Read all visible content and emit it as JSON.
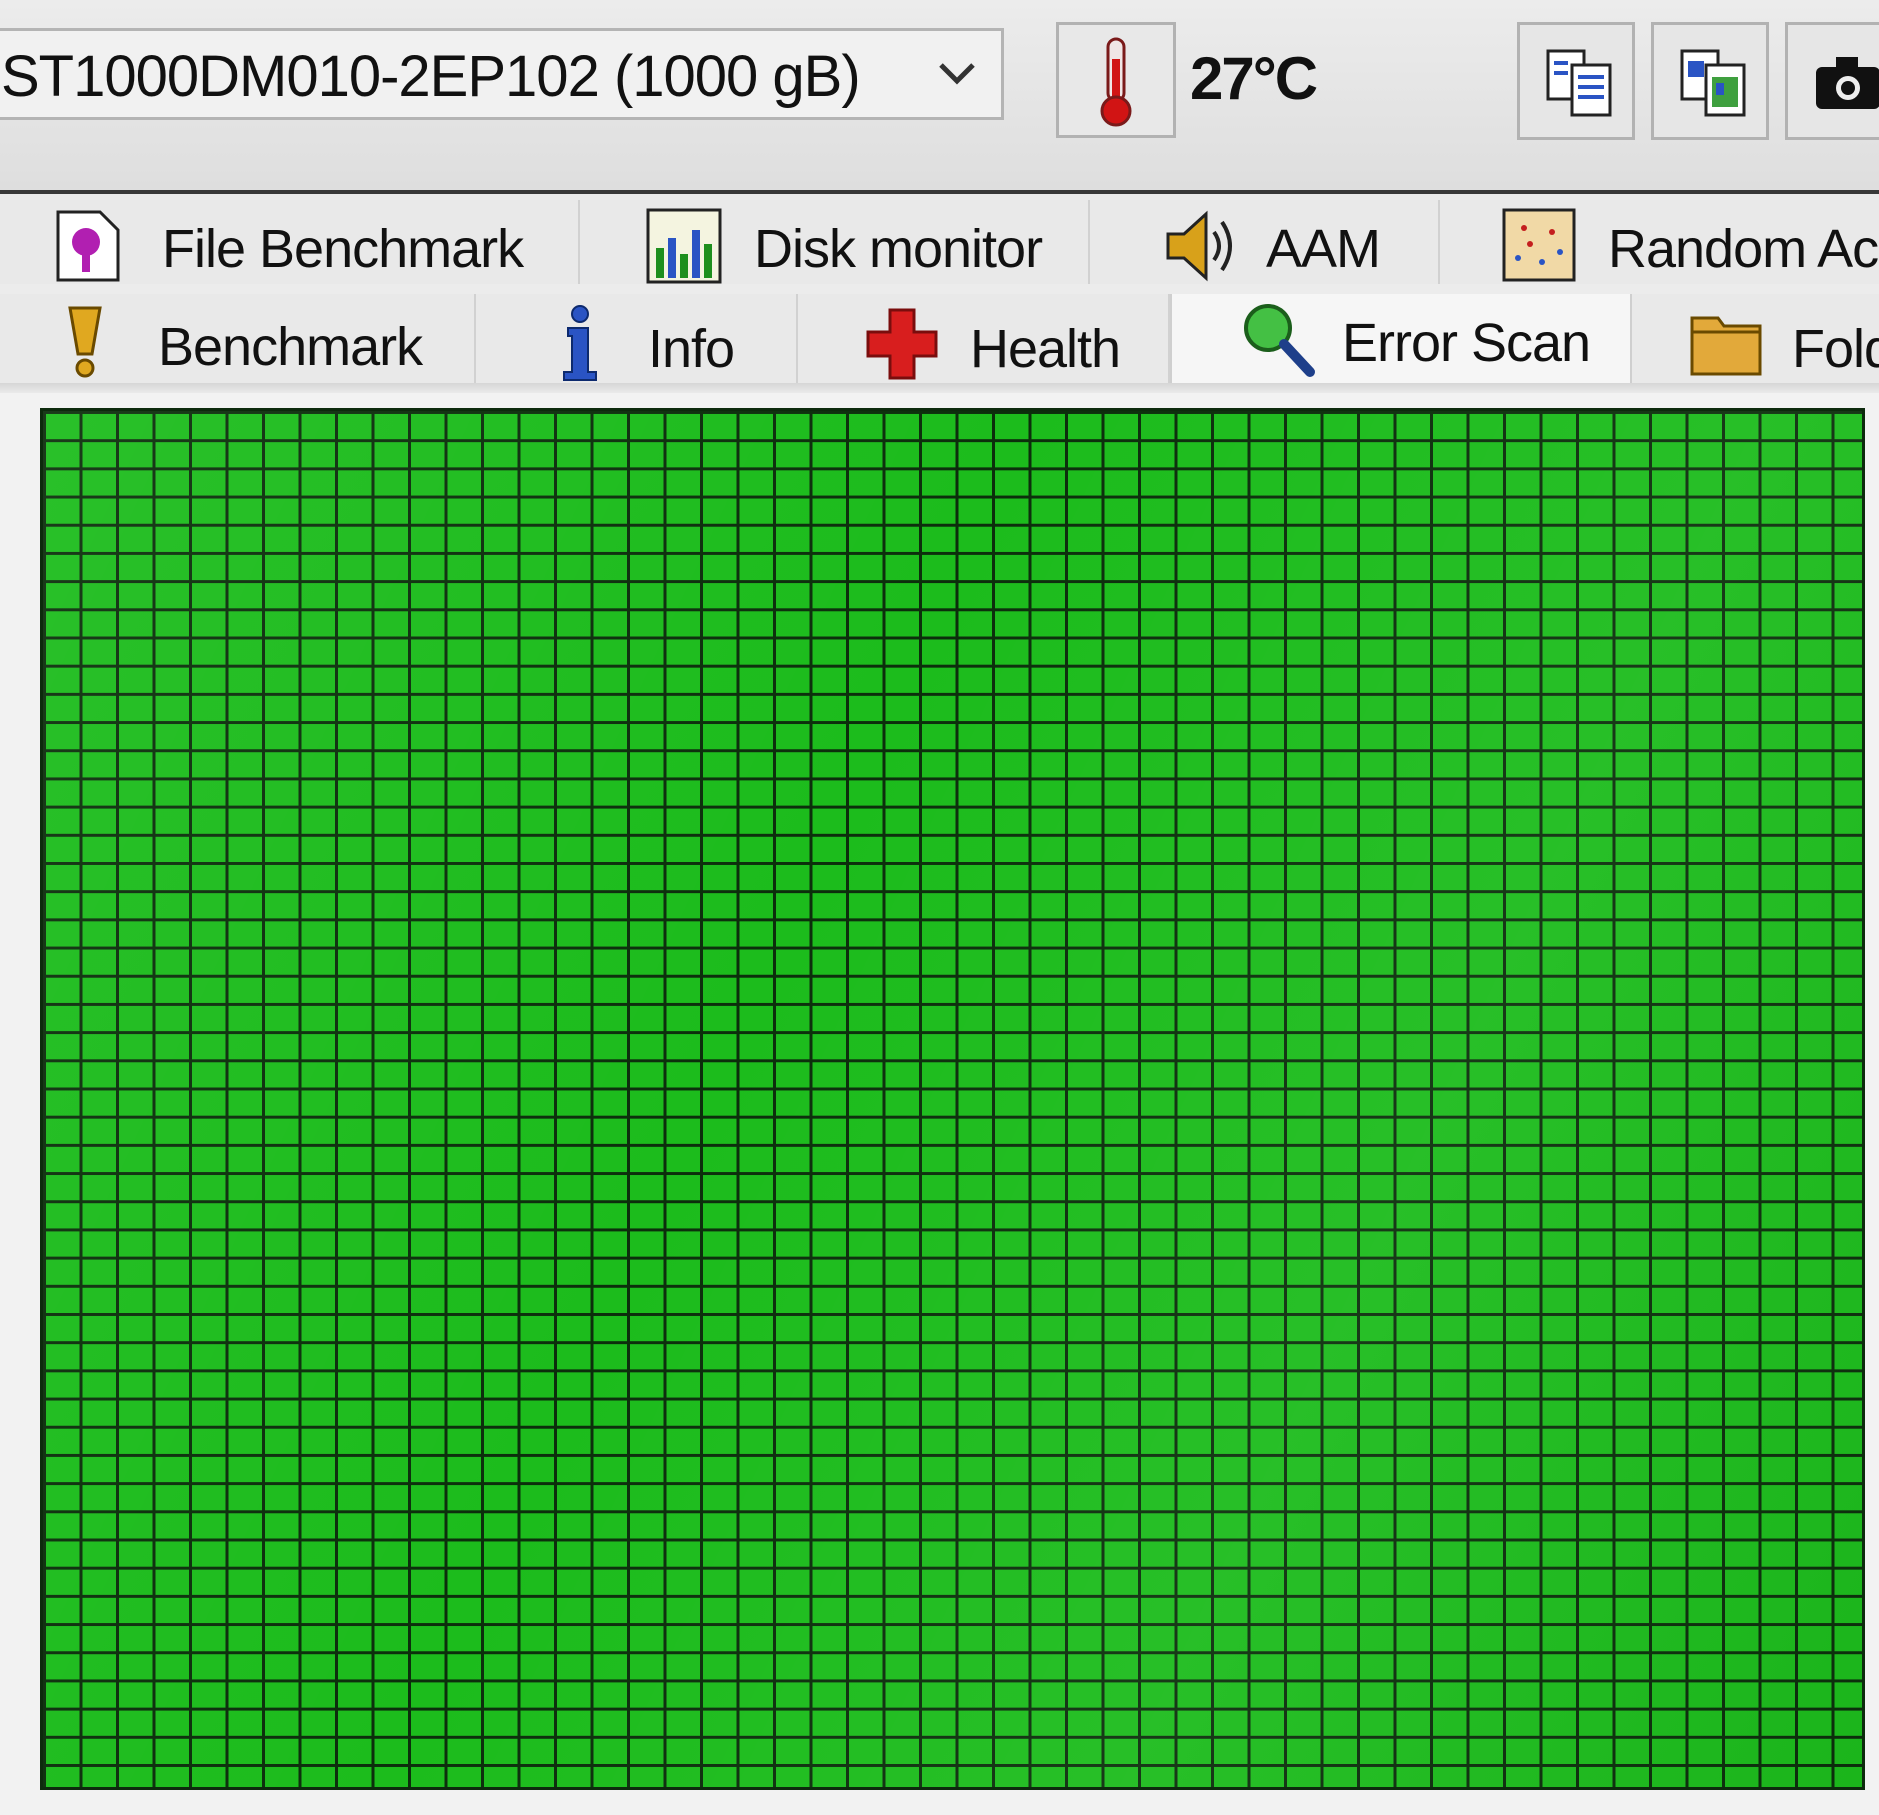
{
  "toolbar": {
    "drive_label": "ST1000DM010-2EP102 (1000 gB)",
    "temperature": "27°C",
    "icons": [
      "chevron-down-icon",
      "thermometer-icon",
      "copy-text-icon",
      "copy-image-icon",
      "camera-icon"
    ]
  },
  "tabs": {
    "row1": [
      {
        "label": "File Benchmark",
        "icon": "file-benchmark-icon"
      },
      {
        "label": "Disk monitor",
        "icon": "bar-chart-icon"
      },
      {
        "label": "AAM",
        "icon": "speaker-icon"
      },
      {
        "label": "Random Acc",
        "icon": "random-access-icon"
      }
    ],
    "row2": [
      {
        "label": "Benchmark",
        "icon": "exclamation-icon"
      },
      {
        "label": "Info",
        "icon": "info-icon"
      },
      {
        "label": "Health",
        "icon": "red-cross-icon"
      },
      {
        "label": "Error Scan",
        "icon": "magnifier-icon",
        "active": true
      },
      {
        "label": "Fold",
        "icon": "folder-icon"
      }
    ]
  },
  "scan": {
    "block_status": "all-ok",
    "colors": {
      "ok_block": "#1cbc1c",
      "grid_line": "#0c2e0c"
    }
  }
}
